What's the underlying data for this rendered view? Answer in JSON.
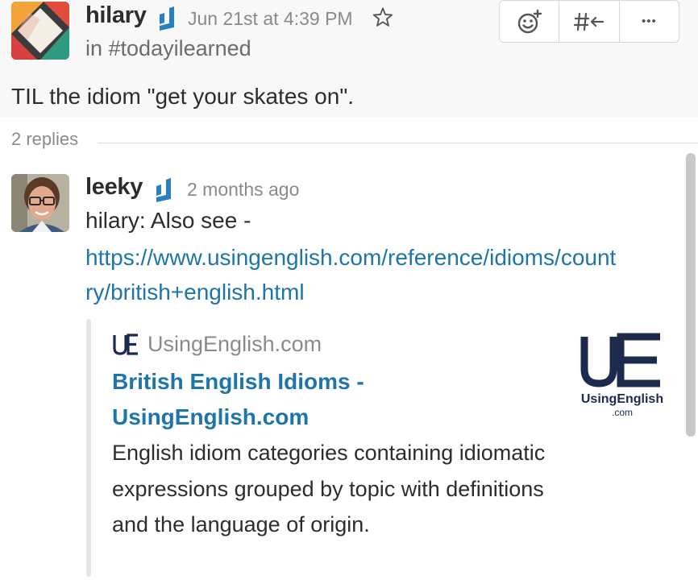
{
  "parent_message": {
    "author": "hilary",
    "timestamp": "Jun 21st at 4:39 PM",
    "channel": "in #todayilearned",
    "text": "TIL the idiom \"get your skates on\"."
  },
  "actions": {
    "add_reaction_icon": "emoji-add-icon",
    "share_icon": "share-channel-icon",
    "more_label": "•••"
  },
  "thread": {
    "replies_label": "2 replies"
  },
  "reply": {
    "author": "leeky",
    "timestamp": "2 months ago",
    "text": "hilary: Also see -",
    "link_line1": "https://www.usingenglish.com/reference/idioms/count",
    "link_line2": "ry/british+english.html"
  },
  "unfurl": {
    "site_logo_text": "UE",
    "site_name": "UsingEnglish.com",
    "title_line1": "British English Idioms -",
    "title_line2": "UsingEnglish.com",
    "description": "English idiom categories containing idiomatic expressions grouped by topic with definitions and the language of origin.",
    "thumb_big": "UE",
    "thumb_name": "UsingEnglish",
    "thumb_sub": ".com"
  },
  "colors": {
    "link": "#1d75ab",
    "verified": "#2a7fc1",
    "thumb_navy": "#1c2a4d"
  }
}
